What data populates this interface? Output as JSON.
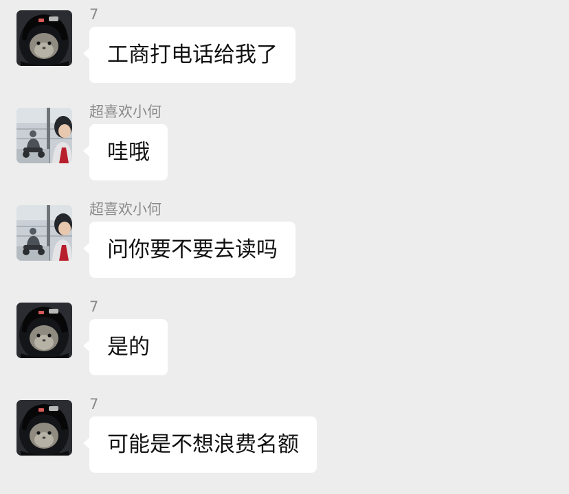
{
  "messages": [
    {
      "sender": "7",
      "avatar": "helmet-cat-avatar",
      "text": "工商打电话给我了"
    },
    {
      "sender": "超喜欢小何",
      "avatar": "window-photo-avatar",
      "text": "哇哦"
    },
    {
      "sender": "超喜欢小何",
      "avatar": "window-photo-avatar",
      "text": "问你要不要去读吗"
    },
    {
      "sender": "7",
      "avatar": "helmet-cat-avatar",
      "text": "是的"
    },
    {
      "sender": "7",
      "avatar": "helmet-cat-avatar",
      "text": "可能是不想浪费名额"
    }
  ],
  "colors": {
    "background": "#ededed",
    "bubble": "#ffffff",
    "sender_name": "#8a8a8a",
    "message_text": "#111111"
  }
}
